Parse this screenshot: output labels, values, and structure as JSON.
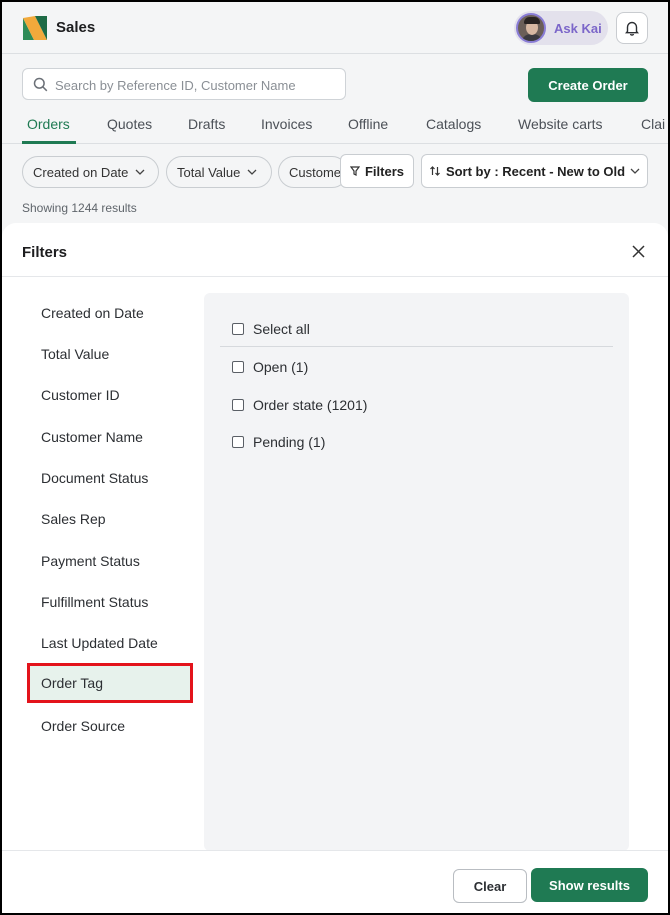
{
  "app": {
    "title": "Sales",
    "ask_label": "Ask Kai"
  },
  "search": {
    "placeholder": "Search by Reference ID, Customer Name",
    "value": ""
  },
  "create_order_label": "Create Order",
  "tabs": [
    "Orders",
    "Quotes",
    "Drafts",
    "Invoices",
    "Offline",
    "Catalogs",
    "Website carts",
    "Clai"
  ],
  "active_tab": "Orders",
  "chips": [
    "Created on Date",
    "Total Value",
    "Custome"
  ],
  "filters_label": "Filters",
  "sort_label": "Sort by : Recent - New to Old",
  "results_text": "Showing 1244 results",
  "modal": {
    "title": "Filters",
    "categories": [
      "Created on Date",
      "Total Value",
      "Customer ID",
      "Customer Name",
      "Document Status",
      "Sales Rep",
      "Payment Status",
      "Fulfillment Status",
      "Last Updated Date",
      "Order Tag",
      "Order Source"
    ],
    "selected_category": "Order Tag",
    "select_all_label": "Select all",
    "options": [
      {
        "label": "Open (1)",
        "checked": false
      },
      {
        "label": "Order state (1201)",
        "checked": false
      },
      {
        "label": "Pending (1)",
        "checked": false
      }
    ],
    "clear_label": "Clear",
    "show_results_label": "Show results"
  },
  "colors": {
    "primary": "#1f7a53",
    "highlight": "#e3131b",
    "accent_purple": "#7b66c9"
  }
}
